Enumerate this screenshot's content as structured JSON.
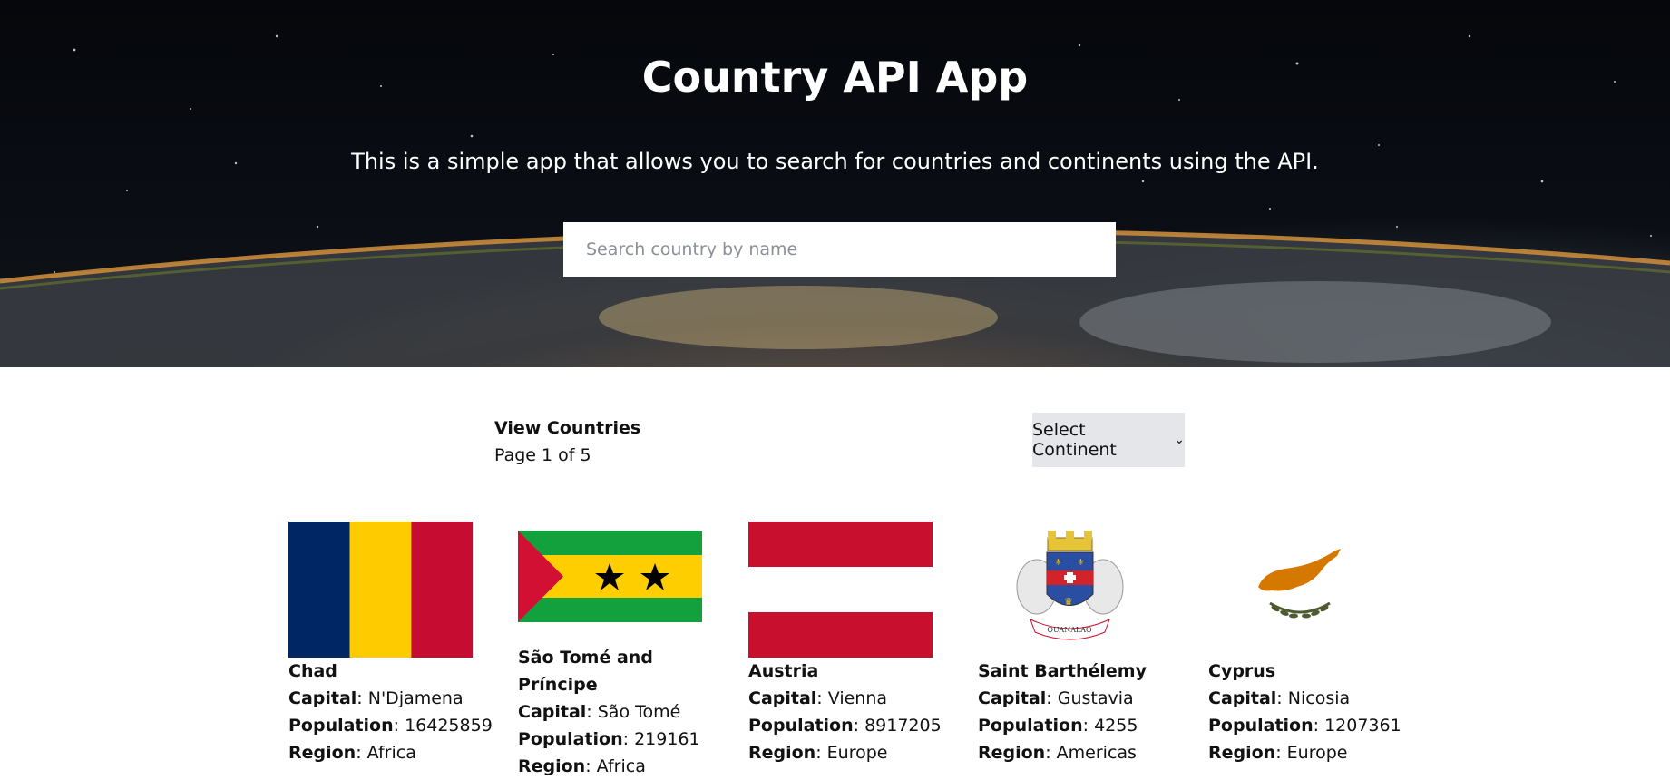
{
  "header": {
    "title": "Country API App",
    "subtitle": "This is a simple app that allows you to search for countries and continents using the API.",
    "search_placeholder": "Search country by name"
  },
  "toolbar": {
    "view_title": "View Countries",
    "page_info": "Page 1 of 5",
    "select_label": "Select Continent"
  },
  "field_labels": {
    "capital": "Capital",
    "population": "Population",
    "region": "Region"
  },
  "countries": [
    {
      "name": "Chad",
      "capital": "N'Djamena",
      "population": "16425859",
      "region": "Africa",
      "flag": "chad-flag"
    },
    {
      "name": "São Tomé and Príncipe",
      "capital": "São Tomé",
      "population": "219161",
      "region": "Africa",
      "flag": "sao-tome-flag"
    },
    {
      "name": "Austria",
      "capital": "Vienna",
      "population": "8917205",
      "region": "Europe",
      "flag": "austria-flag"
    },
    {
      "name": "Saint Barthélemy",
      "capital": "Gustavia",
      "population": "4255",
      "region": "Americas",
      "flag": "saint-barthelemy-flag",
      "flag_motto": "OUANALAO"
    },
    {
      "name": "Cyprus",
      "capital": "Nicosia",
      "population": "1207361",
      "region": "Europe",
      "flag": "cyprus-flag"
    }
  ],
  "colors": {
    "select_bg": "#e5e6ea",
    "hero_bg": "#05070b"
  }
}
